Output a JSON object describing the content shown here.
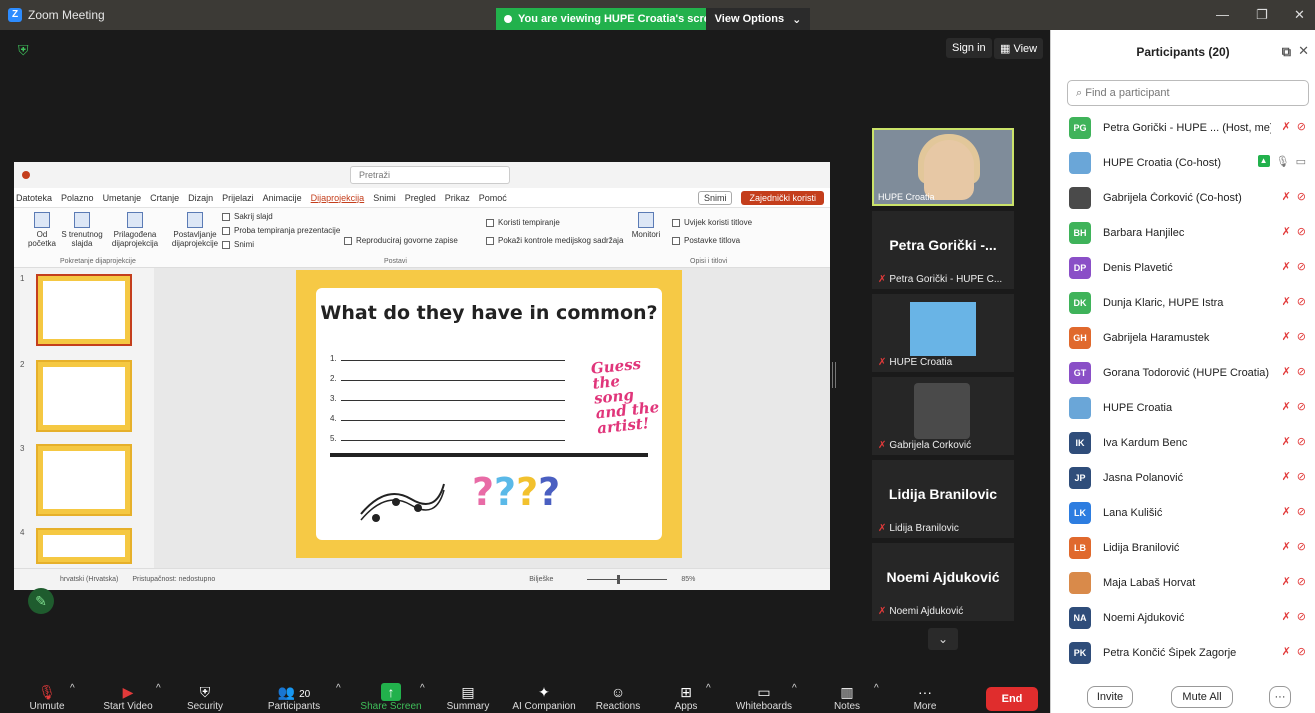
{
  "window": {
    "title": "Zoom Meeting",
    "share_banner": "You are viewing HUPE Croatia's screen",
    "view_options": "View Options",
    "signin": "Sign in",
    "view": "View"
  },
  "ppt": {
    "tabs": [
      "Datoteka",
      "Polazno",
      "Umetanje",
      "Crtanje",
      "Dizajn",
      "Prijelazi",
      "Animacije",
      "Dijaprojekcija",
      "Snimi",
      "Pregled",
      "Prikaz",
      "Pomoć"
    ],
    "active_tab": "Dijaprojekcija",
    "snimi": "Snimi",
    "share": "Zajednički koristi",
    "search": "Pretraži",
    "ribbon": {
      "od_pocetka": "Od početka",
      "trenutnog": "S trenutnog slajda",
      "prilagodena": "Prilagođena dijaprojekcija",
      "postavljanje": "Postavljanje dijaprojekcije",
      "sakrij": "Sakrij slajd",
      "proba": "Proba tempiranja prezentacije",
      "snimi": "Snimi",
      "reproduciraj": "Reproduciraj govorne zapise",
      "koristi": "Koristi tempiranje",
      "kontrole": "Pokaži kontrole medijskog sadržaja",
      "monitori": "Monitori",
      "uvijek": "Uvijek koristi titlove",
      "postavke": "Postavke titlova",
      "group1": "Pokretanje dijaprojekcije",
      "group2": "Postavi",
      "group3": "Opisi i titlovi"
    },
    "slide": {
      "heading": "What do they have in common?",
      "lines": [
        "1.",
        "2.",
        "3.",
        "4.",
        "5."
      ],
      "guess": "Guess the song and the artist!",
      "qmarks": [
        "?",
        "?",
        "?",
        "?"
      ]
    },
    "thumb_numbers": [
      "1",
      "2",
      "3",
      "4"
    ],
    "status": {
      "language": "hrvatski (Hrvatska)",
      "accessibility": "Pristupačnost: nedostupno",
      "notes": "Bilješke",
      "zoom": "85%"
    }
  },
  "video_tiles": [
    {
      "type": "video",
      "label": "HUPE Croatia"
    },
    {
      "type": "name",
      "big": "Petra Gorički -...",
      "caption": "Petra Gorički - HUPE C..."
    },
    {
      "type": "logo",
      "caption": "HUPE Croatia"
    },
    {
      "type": "avatar",
      "caption": "Gabrijela Čorković"
    },
    {
      "type": "name",
      "big": "Lidija Branilovic",
      "caption": "Lidija Branilovic"
    },
    {
      "type": "name",
      "big": "Noemi Ajduković",
      "caption": "Noemi Ajduković"
    }
  ],
  "toolbar": [
    {
      "label": "Unmute",
      "icon": "mic-off-icon"
    },
    {
      "label": "Start Video",
      "icon": "video-off-icon"
    },
    {
      "label": "Security",
      "icon": "shield-icon"
    },
    {
      "label": "Participants",
      "icon": "participants-icon",
      "count": "20"
    },
    {
      "label": "Share Screen",
      "icon": "share-icon"
    },
    {
      "label": "Summary",
      "icon": "summary-icon"
    },
    {
      "label": "AI Companion",
      "icon": "sparkle-icon"
    },
    {
      "label": "Reactions",
      "icon": "reaction-icon"
    },
    {
      "label": "Apps",
      "icon": "apps-icon"
    },
    {
      "label": "Whiteboards",
      "icon": "whiteboard-icon"
    },
    {
      "label": "Notes",
      "icon": "notes-icon"
    },
    {
      "label": "More",
      "icon": "more-icon"
    }
  ],
  "end_label": "End",
  "panel": {
    "title": "Participants (20)",
    "search_placeholder": "Find a participant",
    "participants": [
      {
        "initials": "PG",
        "name": "Petra Gorički - HUPE ...  (Host, me)",
        "color": "#3fb35a"
      },
      {
        "initials": "",
        "name": "HUPE Croatia (Co-host)",
        "color": "#6aa6d8"
      },
      {
        "initials": "",
        "name": "Gabrijela Čorković (Co-host)",
        "color": "#4a4a4a"
      },
      {
        "initials": "BH",
        "name": "Barbara Hanjilec",
        "color": "#3fb35a"
      },
      {
        "initials": "DP",
        "name": "Denis Plavetić",
        "color": "#8a4fc7"
      },
      {
        "initials": "DK",
        "name": "Dunja Klaric, HUPE Istra",
        "color": "#3fb35a"
      },
      {
        "initials": "GH",
        "name": "Gabrijela Haramustek",
        "color": "#e0692d"
      },
      {
        "initials": "GT",
        "name": "Gorana Todorović (HUPE Croatia)",
        "color": "#8a4fc7"
      },
      {
        "initials": "",
        "name": "HUPE Croatia",
        "color": "#6aa6d8"
      },
      {
        "initials": "IK",
        "name": "Iva Kardum Benc",
        "color": "#2f4d7a"
      },
      {
        "initials": "JP",
        "name": "Jasna Polanović",
        "color": "#2f4d7a"
      },
      {
        "initials": "LK",
        "name": "Lana Kulišić",
        "color": "#2d7de0"
      },
      {
        "initials": "LB",
        "name": "Lidija Branilović",
        "color": "#e0692d"
      },
      {
        "initials": "",
        "name": "Maja Labaš Horvat",
        "color": "#d98a4a"
      },
      {
        "initials": "NA",
        "name": "Noemi Ajduković",
        "color": "#2f4d7a"
      },
      {
        "initials": "PK",
        "name": "Petra Končić Šipek Zagorje",
        "color": "#2f4d7a"
      }
    ],
    "invite": "Invite",
    "mute_all": "Mute All",
    "more": "···"
  }
}
